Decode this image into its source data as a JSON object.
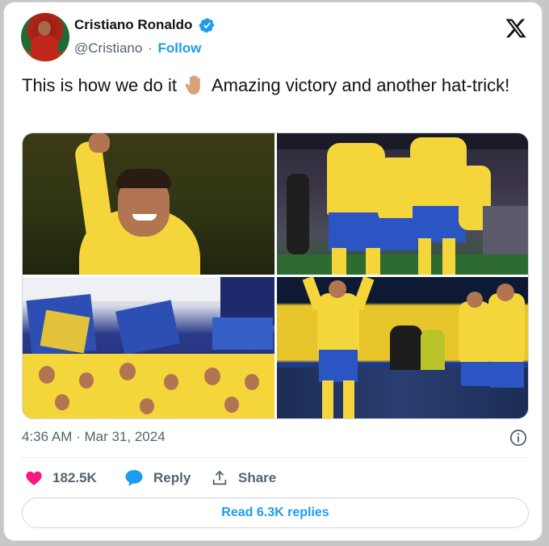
{
  "author": {
    "name": "Cristiano Ronaldo",
    "handle": "@Cristiano",
    "separator": "·",
    "follow_label": "Follow",
    "verified": true
  },
  "icons": {
    "verified": "verified-badge-icon",
    "brand": "x-logo-icon",
    "info": "info-icon",
    "like": "heart-icon",
    "reply": "speech-bubble-icon",
    "share": "share-upload-icon",
    "emoji": "raised-hand-emoji"
  },
  "tweet": {
    "text_before": "This is how we do it",
    "text_after": "Amazing victory and another hat-trick!",
    "timestamp": "4:36 AM · Mar 31, 2024"
  },
  "media": {
    "count": 4
  },
  "actions": {
    "likes": "182.5K",
    "reply_label": "Reply",
    "share_label": "Share"
  },
  "read_replies_label": "Read 6.3K replies",
  "colors": {
    "accent": "#1d9bf0",
    "like": "#f91880",
    "text": "#0f1419",
    "muted": "#536471"
  }
}
